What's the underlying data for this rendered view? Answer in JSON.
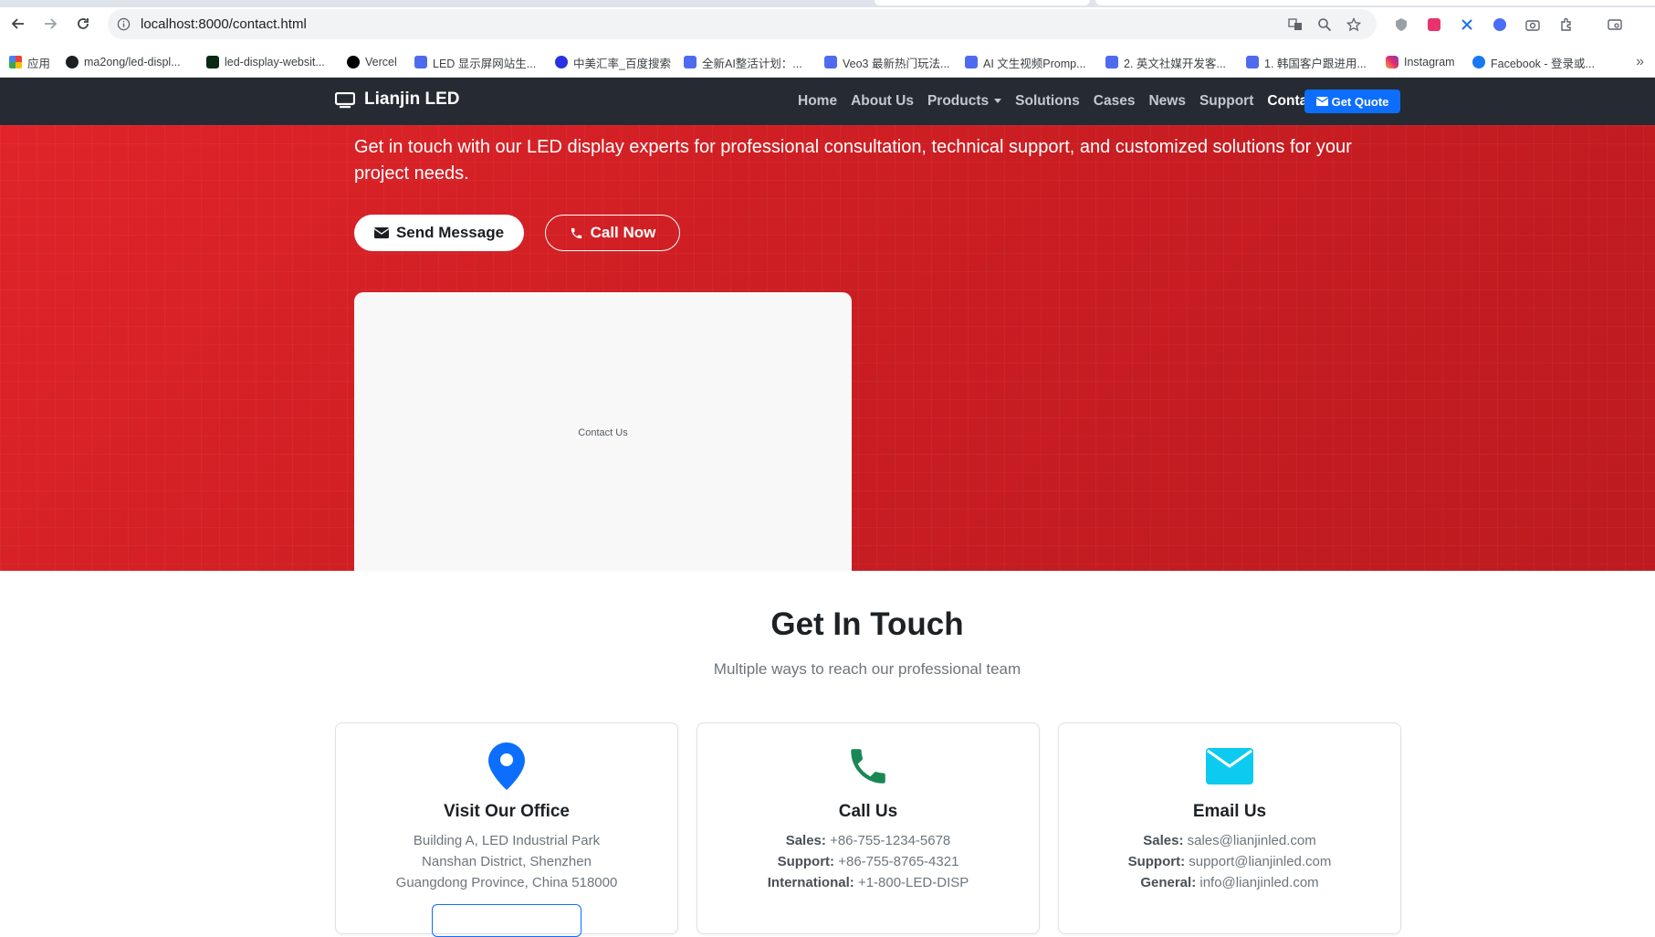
{
  "browser": {
    "url": "localhost:8000/contact.html",
    "bookmarks": [
      {
        "label": "应用",
        "icon": "apps-grid-icon"
      },
      {
        "label": "ma2ong/led-displ...",
        "icon": "github-icon"
      },
      {
        "label": "led-display-websit...",
        "icon": "site-icon"
      },
      {
        "label": "Vercel",
        "icon": "vercel-icon"
      },
      {
        "label": "LED 显示屏网站生...",
        "icon": "doc-icon"
      },
      {
        "label": "中美汇率_百度搜索",
        "icon": "baidu-icon"
      },
      {
        "label": "全新AI整活计划：...",
        "icon": "doc-icon"
      },
      {
        "label": "Veo3 最新热门玩法...",
        "icon": "doc-icon"
      },
      {
        "label": "AI 文生视频Promp...",
        "icon": "doc-icon"
      },
      {
        "label": "2. 英文社媒开发客...",
        "icon": "doc-icon"
      },
      {
        "label": "1. 韩国客户跟进用...",
        "icon": "doc-icon"
      },
      {
        "label": "Instagram",
        "icon": "instagram-icon"
      },
      {
        "label": "Facebook - 登录或...",
        "icon": "facebook-icon"
      }
    ]
  },
  "nav": {
    "brand": "Lianjin LED",
    "links": [
      "Home",
      "About Us",
      "Products",
      "Solutions",
      "Cases",
      "News",
      "Support",
      "Contact"
    ],
    "active": "Contact",
    "quote_label": "Get Quote"
  },
  "hero": {
    "subtitle": "Get in touch with our LED display experts for professional consultation, technical support, and customized solutions for your project needs.",
    "send_label": "Send Message",
    "call_label": "Call Now",
    "card_label": "Contact Us"
  },
  "touch": {
    "title": "Get In Touch",
    "subtitle": "Multiple ways to reach our professional team",
    "cards": [
      {
        "title": "Visit Our Office",
        "icon": "map-pin-icon",
        "color": "#0d6efd",
        "lines": [
          {
            "label": "",
            "value": "Building A, LED Industrial Park"
          },
          {
            "label": "",
            "value": "Nanshan District, Shenzhen"
          },
          {
            "label": "",
            "value": "Guangdong Province, China 518000"
          }
        ]
      },
      {
        "title": "Call Us",
        "icon": "phone-icon",
        "color": "#198754",
        "lines": [
          {
            "label": "Sales:",
            "value": "+86-755-1234-5678"
          },
          {
            "label": "Support:",
            "value": "+86-755-8765-4321"
          },
          {
            "label": "International:",
            "value": "+1-800-LED-DISP"
          }
        ]
      },
      {
        "title": "Email Us",
        "icon": "envelope-icon",
        "color": "#0dcaf0",
        "lines": [
          {
            "label": "Sales:",
            "value": "sales@lianjinled.com"
          },
          {
            "label": "Support:",
            "value": "support@lianjinled.com"
          },
          {
            "label": "General:",
            "value": "info@lianjinled.com"
          }
        ]
      }
    ]
  }
}
